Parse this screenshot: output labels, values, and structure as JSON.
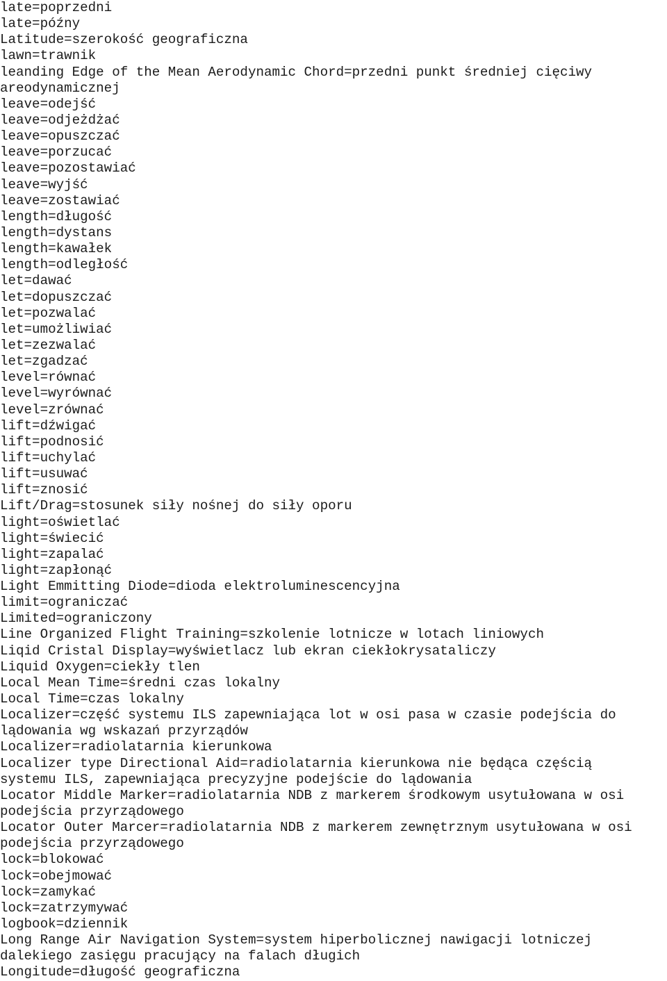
{
  "document": {
    "type": "glossary",
    "language_pair": "English-Polish",
    "section_letter": "L",
    "font_style": "monospace",
    "text_color": "#1b1b1b",
    "background_color": "#ffffff"
  },
  "lines": [
    "late=poprzedni",
    "late=późny",
    "Latitude=szerokość geograficzna",
    "lawn=trawnik",
    "leanding Edge of the Mean Aerodynamic Chord=przedni punkt średniej cięciwy",
    "areodynamicznej",
    "leave=odejść",
    "leave=odjeżdżać",
    "leave=opuszczać",
    "leave=porzucać",
    "leave=pozostawiać",
    "leave=wyjść",
    "leave=zostawiać",
    "length=długość",
    "length=dystans",
    "length=kawałek",
    "length=odległość",
    "let=dawać",
    "let=dopuszczać",
    "let=pozwalać",
    "let=umożliwiać",
    "let=zezwalać",
    "let=zgadzać",
    "level=równać",
    "level=wyrównać",
    "level=zrównać",
    "lift=dźwigać",
    "lift=podnosić",
    "lift=uchylać",
    "lift=usuwać",
    "lift=znosić",
    "Lift/Drag=stosunek siły nośnej do siły oporu",
    "light=oświetlać",
    "light=świecić",
    "light=zapalać",
    "light=zapłonąć",
    "Light Emmitting Diode=dioda elektroluminescencyjna",
    "limit=ograniczać",
    "Limited=ograniczony",
    "Line Organized Flight Training=szkolenie lotnicze w lotach liniowych",
    "Liqid Cristal Display=wyświetlacz lub ekran ciekłokrysataliczy",
    "Liquid Oxygen=ciekły tlen",
    "Local Mean Time=średni czas lokalny",
    "Local Time=czas lokalny",
    "Localizer=część systemu ILS zapewniająca lot w osi pasa w czasie podejścia do",
    "lądowania wg wskazań przyrządów",
    "Localizer=radiolatarnia kierunkowa",
    "Localizer type Directional Aid=radiolatarnia kierunkowa nie będąca częścią",
    "systemu ILS, zapewniająca precyzyjne podejście do lądowania",
    "Locator Middle Marker=radiolatarnia NDB z markerem środkowym usytułowana w osi",
    "podejścia przyrządowego",
    "Locator Outer Marcer=radiolatarnia NDB z markerem zewnętrznym usytułowana w osi",
    "podejścia przyrządowego",
    "lock=blokować",
    "lock=obejmować",
    "lock=zamykać",
    "lock=zatrzymywać",
    "logbook=dziennik",
    "Long Range Air Navigation System=system hiperbolicznej nawigacji lotniczej",
    "dalekiego zasięgu pracujący na falach długich",
    "Longitude=długość geograficzna"
  ]
}
